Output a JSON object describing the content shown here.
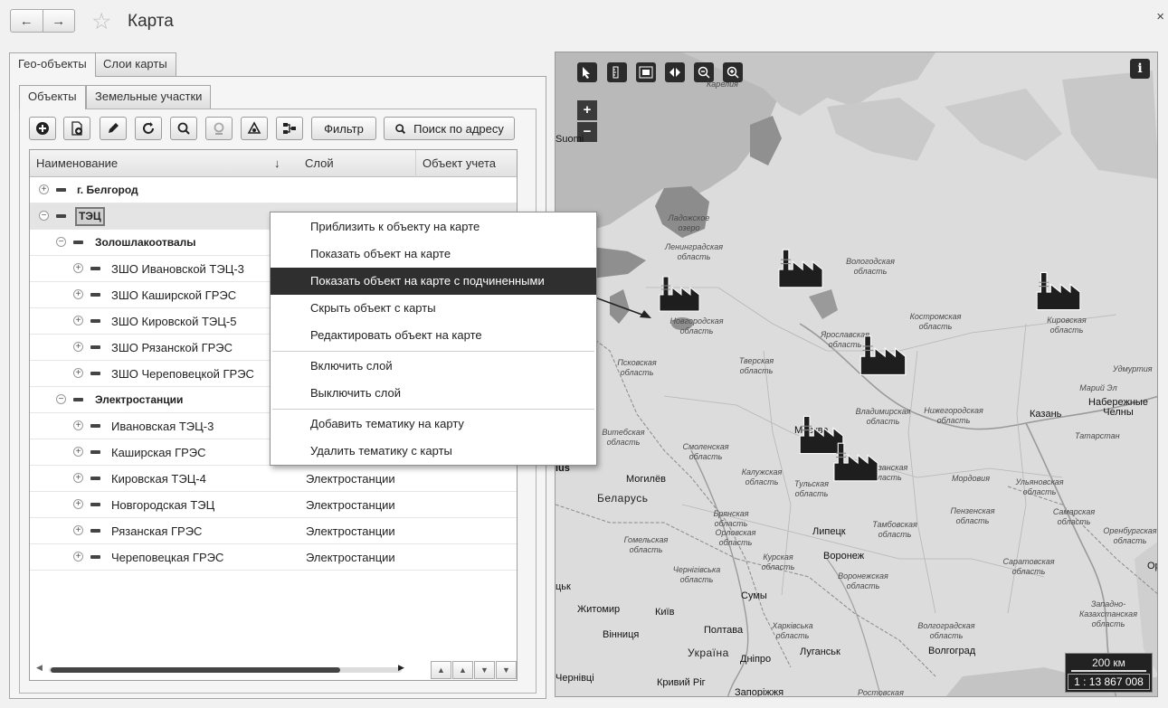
{
  "window": {
    "title": "Карта",
    "back_icon": "arrow-left-icon",
    "forward_icon": "arrow-right-icon",
    "close": "×"
  },
  "left_tabs": [
    "Гео-объекты",
    "Слои карты"
  ],
  "inner_tabs": [
    "Объекты",
    "Земельные участки"
  ],
  "toolbar": {
    "filter_label": "Фильтр",
    "address_search_label": "Поиск по адресу"
  },
  "grid": {
    "columns": [
      "Наименование",
      "Слой",
      "Объект учета"
    ],
    "sort_indicator": "↓",
    "rows": [
      {
        "name": "г. Белгород",
        "layer": ""
      },
      {
        "name": "ТЭЦ",
        "layer": ""
      },
      {
        "name": "Золошлакоотвалы",
        "layer": ""
      },
      {
        "name": "ЗШО Ивановской ТЭЦ-3",
        "layer": ""
      },
      {
        "name": "ЗШО Каширской ГРЭС",
        "layer": ""
      },
      {
        "name": "ЗШО Кировской ТЭЦ-5",
        "layer": ""
      },
      {
        "name": "ЗШО Рязанской ГРЭС",
        "layer": ""
      },
      {
        "name": "ЗШО Череповецкой ГРЭС",
        "layer": ""
      },
      {
        "name": "Электростанции",
        "layer": ""
      },
      {
        "name": "Ивановская ТЭЦ-3",
        "layer": ""
      },
      {
        "name": "Каширская ГРЭС",
        "layer": ""
      },
      {
        "name": "Кировская ТЭЦ-4",
        "layer": "Электростанции"
      },
      {
        "name": "Новгородская ТЭЦ",
        "layer": "Электростанции"
      },
      {
        "name": "Рязанская ГРЭС",
        "layer": "Электростанции"
      },
      {
        "name": "Череповецкая ГРЭС",
        "layer": "Электростанции"
      }
    ]
  },
  "context_menu": {
    "items": [
      "Приблизить к объекту на карте",
      "Показать объект на карте",
      "Показать объект на карте с подчиненными",
      "Скрыть объект с карты",
      "Редактировать объект на карте",
      "Включить слой",
      "Выключить слой",
      "Добавить тематику на карту",
      "Удалить тематику с карты"
    ],
    "highlighted_index": 2
  },
  "map": {
    "zoom_in": "+",
    "zoom_out": "−",
    "info": "i",
    "scale_distance": "200 км",
    "scale_ratio": "1 : 13 867 008",
    "labels": [
      "Карелия",
      "Suomi",
      "Ладожское озеро",
      "Ленинградская область",
      "Вологодская область",
      "Новгородская область",
      "Костромская область",
      "Кировская область",
      "Ярославская область",
      "Псковская область",
      "Тверская область",
      "Удмуртия",
      "Марий Эл",
      "Набережные Челны",
      "Владимирская область",
      "Нижегородская область",
      "Казань",
      "Витебская область",
      "Москва",
      "Смоленская область",
      "Татарстан",
      "Калужская область",
      "Тульская область",
      "Рязанская область",
      "Мордовия",
      "Ульяновская область",
      "Могилёв",
      "Беларусь",
      "Брянская область",
      "Пензенская область",
      "Самарская область",
      "Гомельская область",
      "Орловская область",
      "Липецк",
      "Тамбовская область",
      "Оренбургская область",
      "Чернiгiвська область",
      "Курская область",
      "Воронеж",
      "Саратовская область",
      "Воронежская область",
      "Сумы",
      "Житомир",
      "Київ",
      "Полтава",
      "Харківська область",
      "Западно-Казахстанская область",
      "Вінниця",
      "Україна",
      "Луганськ",
      "Дніпро",
      "Волгоград",
      "Волгоградская область",
      "Кривий Ріг",
      "Запоріжжя",
      "Ростовская",
      "Чернівці",
      "lus",
      "Орл",
      "цьк"
    ]
  }
}
